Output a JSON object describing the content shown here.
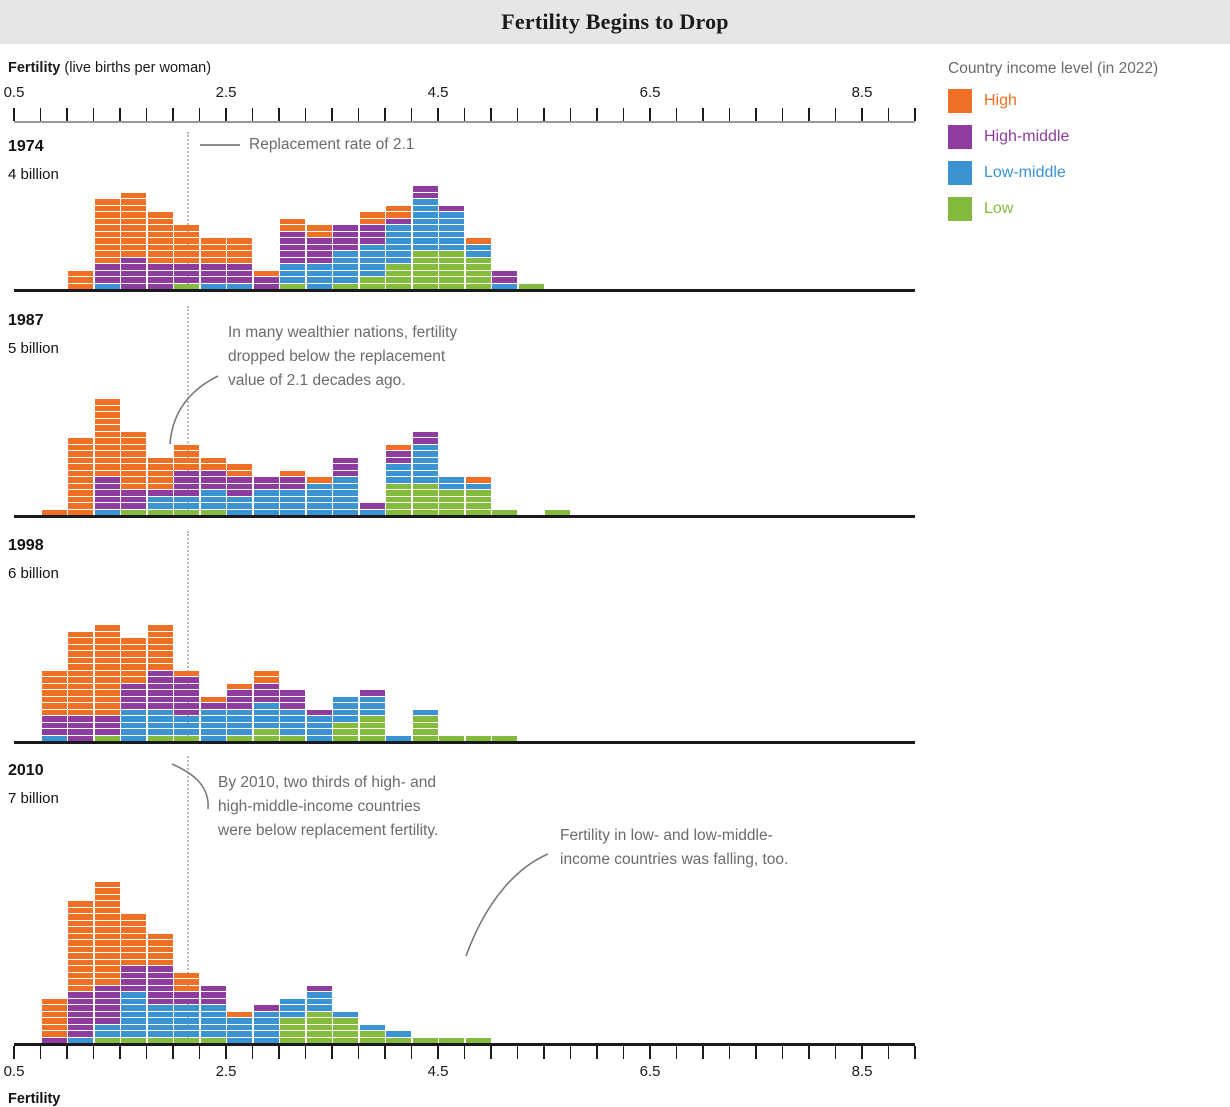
{
  "header": {
    "title": "Fertility Begins to Drop"
  },
  "axis": {
    "label_bold": "Fertility",
    "label_rest": "(live births per woman)",
    "bottom_label": "Fertility",
    "tick_values": [
      0.5,
      2.5,
      4.5,
      6.5,
      8.5
    ],
    "tick_labels": [
      "0.5",
      "2.5",
      "4.5",
      "6.5",
      "8.5"
    ],
    "minor_step": 0.25,
    "range": [
      0.5,
      9.0
    ]
  },
  "replacement": {
    "value": 2.1,
    "label": "Replacement rate of 2.1"
  },
  "legend": {
    "title": "Country income level (in 2022)",
    "items": [
      {
        "label": "High",
        "color": "#ed7024"
      },
      {
        "label": "High-middle",
        "color": "#8e3c9e"
      },
      {
        "label": "Low-middle",
        "color": "#3b94d1"
      },
      {
        "label": "Low",
        "color": "#84bb3f"
      }
    ]
  },
  "annotations": [
    {
      "id": "anno-1987",
      "lines": [
        "In many wealthier nations, fertility",
        "dropped below the replacement",
        "value of 2.1 decades ago."
      ]
    },
    {
      "id": "anno-2010-a",
      "lines": [
        "By 2010, two thirds of high- and",
        "high-middle-income countries",
        "were below replacement fertility."
      ]
    },
    {
      "id": "anno-2010-b",
      "lines": [
        "Fertility in low- and low-middle-",
        "income countries was falling, too."
      ]
    }
  ],
  "chart_data": {
    "type": "bar",
    "title": "Fertility Begins to Drop",
    "xlabel": "Fertility (live births per woman)",
    "ylabel": "",
    "xlim": [
      0.5,
      9.0
    ],
    "bin_width": 0.25,
    "grid": false,
    "legend_position": "right",
    "stack_order": [
      "High",
      "High-middle",
      "Low-middle",
      "Low"
    ],
    "series_colors": {
      "High": "#ed7024",
      "High-middle": "#8e3c9e",
      "Low-middle": "#3b94d1",
      "Low": "#84bb3f"
    },
    "unit": "countries (1 block = 1 country)",
    "panels": [
      {
        "year": "1974",
        "population": "4 billion",
        "bins": [
          {
            "x": 1.0,
            "High": 3,
            "High-middle": 0,
            "Low-middle": 0,
            "Low": 0
          },
          {
            "x": 1.25,
            "High": 10,
            "High-middle": 3,
            "Low-middle": 1,
            "Low": 0
          },
          {
            "x": 1.5,
            "High": 10,
            "High-middle": 5,
            "Low-middle": 0,
            "Low": 0
          },
          {
            "x": 1.75,
            "High": 8,
            "High-middle": 4,
            "Low-middle": 0,
            "Low": 0
          },
          {
            "x": 2.0,
            "High": 6,
            "High-middle": 3,
            "Low-middle": 0,
            "Low": 1
          },
          {
            "x": 2.25,
            "High": 4,
            "High-middle": 3,
            "Low-middle": 1,
            "Low": 0
          },
          {
            "x": 2.5,
            "High": 4,
            "High-middle": 3,
            "Low-middle": 1,
            "Low": 0
          },
          {
            "x": 2.75,
            "High": 1,
            "High-middle": 2,
            "Low-middle": 0,
            "Low": 0
          },
          {
            "x": 3.0,
            "High": 2,
            "High-middle": 5,
            "Low-middle": 3,
            "Low": 1
          },
          {
            "x": 3.25,
            "High": 2,
            "High-middle": 4,
            "Low-middle": 4,
            "Low": 0
          },
          {
            "x": 3.5,
            "High": 0,
            "High-middle": 4,
            "Low-middle": 5,
            "Low": 1
          },
          {
            "x": 3.75,
            "High": 2,
            "High-middle": 3,
            "Low-middle": 5,
            "Low": 2
          },
          {
            "x": 4.0,
            "High": 2,
            "High-middle": 1,
            "Low-middle": 6,
            "Low": 4
          },
          {
            "x": 4.25,
            "High": 0,
            "High-middle": 2,
            "Low-middle": 8,
            "Low": 6
          },
          {
            "x": 4.5,
            "High": 0,
            "High-middle": 1,
            "Low-middle": 6,
            "Low": 6
          },
          {
            "x": 4.75,
            "High": 1,
            "High-middle": 0,
            "Low-middle": 2,
            "Low": 5
          },
          {
            "x": 5.0,
            "High": 0,
            "High-middle": 2,
            "Low-middle": 1,
            "Low": 0
          },
          {
            "x": 5.25,
            "High": 0,
            "High-middle": 0,
            "Low-middle": 0,
            "Low": 1
          }
        ]
      },
      {
        "year": "1987",
        "population": "5 billion",
        "bins": [
          {
            "x": 0.75,
            "High": 1,
            "High-middle": 0,
            "Low-middle": 0,
            "Low": 0
          },
          {
            "x": 1.0,
            "High": 12,
            "High-middle": 0,
            "Low-middle": 0,
            "Low": 0
          },
          {
            "x": 1.25,
            "High": 12,
            "High-middle": 5,
            "Low-middle": 1,
            "Low": 0
          },
          {
            "x": 1.5,
            "High": 9,
            "High-middle": 3,
            "Low-middle": 0,
            "Low": 1
          },
          {
            "x": 1.75,
            "High": 5,
            "High-middle": 1,
            "Low-middle": 2,
            "Low": 1
          },
          {
            "x": 2.0,
            "High": 4,
            "High-middle": 4,
            "Low-middle": 2,
            "Low": 1
          },
          {
            "x": 2.25,
            "High": 2,
            "High-middle": 3,
            "Low-middle": 3,
            "Low": 1
          },
          {
            "x": 2.5,
            "High": 2,
            "High-middle": 3,
            "Low-middle": 3,
            "Low": 0
          },
          {
            "x": 2.75,
            "High": 0,
            "High-middle": 2,
            "Low-middle": 4,
            "Low": 0
          },
          {
            "x": 3.0,
            "High": 1,
            "High-middle": 2,
            "Low-middle": 4,
            "Low": 0
          },
          {
            "x": 3.25,
            "High": 1,
            "High-middle": 0,
            "Low-middle": 5,
            "Low": 0
          },
          {
            "x": 3.5,
            "High": 0,
            "High-middle": 3,
            "Low-middle": 6,
            "Low": 0
          },
          {
            "x": 3.75,
            "High": 0,
            "High-middle": 1,
            "Low-middle": 1,
            "Low": 0
          },
          {
            "x": 4.0,
            "High": 1,
            "High-middle": 2,
            "Low-middle": 3,
            "Low": 5
          },
          {
            "x": 4.25,
            "High": 0,
            "High-middle": 2,
            "Low-middle": 6,
            "Low": 5
          },
          {
            "x": 4.5,
            "High": 0,
            "High-middle": 0,
            "Low-middle": 2,
            "Low": 4
          },
          {
            "x": 4.75,
            "High": 1,
            "High-middle": 0,
            "Low-middle": 1,
            "Low": 4
          },
          {
            "x": 5.0,
            "High": 0,
            "High-middle": 0,
            "Low-middle": 0,
            "Low": 1
          },
          {
            "x": 5.5,
            "High": 0,
            "High-middle": 0,
            "Low-middle": 0,
            "Low": 1
          }
        ]
      },
      {
        "year": "1998",
        "population": "6 billion",
        "bins": [
          {
            "x": 0.75,
            "High": 7,
            "High-middle": 3,
            "Low-middle": 1,
            "Low": 0
          },
          {
            "x": 1.0,
            "High": 13,
            "High-middle": 4,
            "Low-middle": 0,
            "Low": 0
          },
          {
            "x": 1.25,
            "High": 14,
            "High-middle": 3,
            "Low-middle": 0,
            "Low": 1
          },
          {
            "x": 1.5,
            "High": 7,
            "High-middle": 4,
            "Low-middle": 5,
            "Low": 0
          },
          {
            "x": 1.75,
            "High": 7,
            "High-middle": 6,
            "Low-middle": 4,
            "Low": 1
          },
          {
            "x": 2.0,
            "High": 1,
            "High-middle": 6,
            "Low-middle": 3,
            "Low": 1
          },
          {
            "x": 2.25,
            "High": 1,
            "High-middle": 1,
            "Low-middle": 5,
            "Low": 0
          },
          {
            "x": 2.5,
            "High": 1,
            "High-middle": 3,
            "Low-middle": 4,
            "Low": 1
          },
          {
            "x": 2.75,
            "High": 2,
            "High-middle": 3,
            "Low-middle": 4,
            "Low": 2
          },
          {
            "x": 3.0,
            "High": 0,
            "High-middle": 3,
            "Low-middle": 4,
            "Low": 1
          },
          {
            "x": 3.25,
            "High": 0,
            "High-middle": 1,
            "Low-middle": 4,
            "Low": 0
          },
          {
            "x": 3.5,
            "High": 0,
            "High-middle": 0,
            "Low-middle": 4,
            "Low": 3
          },
          {
            "x": 3.75,
            "High": 0,
            "High-middle": 1,
            "Low-middle": 3,
            "Low": 4
          },
          {
            "x": 4.0,
            "High": 0,
            "High-middle": 0,
            "Low-middle": 1,
            "Low": 0
          },
          {
            "x": 4.25,
            "High": 0,
            "High-middle": 0,
            "Low-middle": 1,
            "Low": 4
          },
          {
            "x": 4.5,
            "High": 0,
            "High-middle": 0,
            "Low-middle": 0,
            "Low": 1
          },
          {
            "x": 4.75,
            "High": 0,
            "High-middle": 0,
            "Low-middle": 0,
            "Low": 1
          },
          {
            "x": 5.0,
            "High": 0,
            "High-middle": 0,
            "Low-middle": 0,
            "Low": 1
          }
        ]
      },
      {
        "year": "2010",
        "population": "7 billion",
        "bins": [
          {
            "x": 0.75,
            "High": 6,
            "High-middle": 1,
            "Low-middle": 0,
            "Low": 0
          },
          {
            "x": 1.0,
            "High": 14,
            "High-middle": 7,
            "Low-middle": 1,
            "Low": 0
          },
          {
            "x": 1.25,
            "High": 16,
            "High-middle": 6,
            "Low-middle": 2,
            "Low": 1
          },
          {
            "x": 1.5,
            "High": 8,
            "High-middle": 4,
            "Low-middle": 7,
            "Low": 1
          },
          {
            "x": 1.75,
            "High": 5,
            "High-middle": 6,
            "Low-middle": 5,
            "Low": 1
          },
          {
            "x": 2.0,
            "High": 3,
            "High-middle": 2,
            "Low-middle": 5,
            "Low": 1
          },
          {
            "x": 2.25,
            "High": 0,
            "High-middle": 3,
            "Low-middle": 5,
            "Low": 1
          },
          {
            "x": 2.5,
            "High": 1,
            "High-middle": 0,
            "Low-middle": 4,
            "Low": 0
          },
          {
            "x": 2.75,
            "High": 0,
            "High-middle": 1,
            "Low-middle": 5,
            "Low": 0
          },
          {
            "x": 3.0,
            "High": 0,
            "High-middle": 0,
            "Low-middle": 3,
            "Low": 4
          },
          {
            "x": 3.25,
            "High": 0,
            "High-middle": 1,
            "Low-middle": 3,
            "Low": 5
          },
          {
            "x": 3.5,
            "High": 0,
            "High-middle": 0,
            "Low-middle": 1,
            "Low": 4
          },
          {
            "x": 3.75,
            "High": 0,
            "High-middle": 0,
            "Low-middle": 1,
            "Low": 2
          },
          {
            "x": 4.0,
            "High": 0,
            "High-middle": 0,
            "Low-middle": 1,
            "Low": 1
          },
          {
            "x": 4.25,
            "High": 0,
            "High-middle": 0,
            "Low-middle": 0,
            "Low": 1
          },
          {
            "x": 4.5,
            "High": 0,
            "High-middle": 0,
            "Low-middle": 0,
            "Low": 1
          },
          {
            "x": 4.75,
            "High": 0,
            "High-middle": 0,
            "Low-middle": 0,
            "Low": 1
          }
        ]
      }
    ]
  }
}
